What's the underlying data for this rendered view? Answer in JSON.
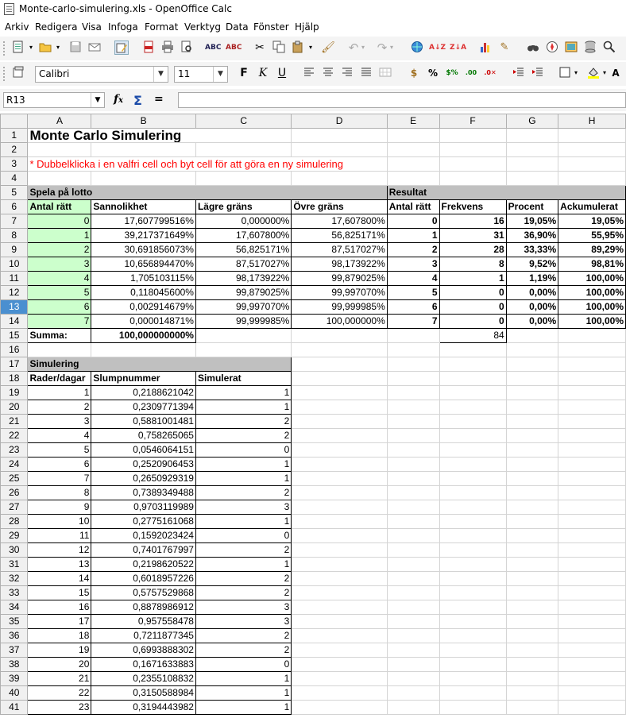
{
  "window": {
    "title": "Monte-carlo-simulering.xls - OpenOffice Calc"
  },
  "menu": [
    "Arkiv",
    "Redigera",
    "Visa",
    "Infoga",
    "Format",
    "Verktyg",
    "Data",
    "Fönster",
    "Hjälp"
  ],
  "format_bar": {
    "font_name": "Calibri",
    "font_size": "11",
    "bold": "F",
    "italic": "K",
    "underline": "U"
  },
  "formula_bar": {
    "cell_ref": "R13",
    "content": ""
  },
  "columns": [
    "A",
    "B",
    "C",
    "D",
    "E",
    "F",
    "G",
    "H"
  ],
  "selected_row": "13",
  "sheet": {
    "title": "Monte Carlo Simulering",
    "note": "* Dubbelklicka i en valfri cell och byt cell för att göra en ny simulering",
    "lotto": {
      "section": "Spela på lotto",
      "headers": [
        "Antal rätt",
        "Sannolikhet",
        "Lägre gräns",
        "Övre gräns"
      ],
      "rows": [
        [
          "0",
          "17,607799516%",
          "0,000000%",
          "17,607800%"
        ],
        [
          "1",
          "39,217371649%",
          "17,607800%",
          "56,825171%"
        ],
        [
          "2",
          "30,691856073%",
          "56,825171%",
          "87,517027%"
        ],
        [
          "3",
          "10,656894470%",
          "87,517027%",
          "98,173922%"
        ],
        [
          "4",
          "1,705103115%",
          "98,173922%",
          "99,879025%"
        ],
        [
          "5",
          "0,118045600%",
          "99,879025%",
          "99,997070%"
        ],
        [
          "6",
          "0,002914679%",
          "99,997070%",
          "99,999985%"
        ],
        [
          "7",
          "0,000014871%",
          "99,999985%",
          "100,000000%"
        ]
      ],
      "sum_label": "Summa:",
      "sum_value": "100,000000000%"
    },
    "result": {
      "section": "Resultat",
      "headers": [
        "Antal rätt",
        "Frekvens",
        "Procent",
        "Ackumulerat"
      ],
      "rows": [
        [
          "0",
          "16",
          "19,05%",
          "19,05%"
        ],
        [
          "1",
          "31",
          "36,90%",
          "55,95%"
        ],
        [
          "2",
          "28",
          "33,33%",
          "89,29%"
        ],
        [
          "3",
          "8",
          "9,52%",
          "98,81%"
        ],
        [
          "4",
          "1",
          "1,19%",
          "100,00%"
        ],
        [
          "5",
          "0",
          "0,00%",
          "100,00%"
        ],
        [
          "6",
          "0",
          "0,00%",
          "100,00%"
        ],
        [
          "7",
          "0",
          "0,00%",
          "100,00%"
        ]
      ],
      "total": "84"
    },
    "simulation": {
      "section": "Simulering",
      "headers": [
        "Rader/dagar",
        "Slumpnummer",
        "Simulerat"
      ],
      "rows": [
        [
          "1",
          "0,2188621042",
          "1"
        ],
        [
          "2",
          "0,2309771394",
          "1"
        ],
        [
          "3",
          "0,5881001481",
          "2"
        ],
        [
          "4",
          "0,758265065",
          "2"
        ],
        [
          "5",
          "0,0546064151",
          "0"
        ],
        [
          "6",
          "0,2520906453",
          "1"
        ],
        [
          "7",
          "0,2650929319",
          "1"
        ],
        [
          "8",
          "0,7389349488",
          "2"
        ],
        [
          "9",
          "0,9703119989",
          "3"
        ],
        [
          "10",
          "0,2775161068",
          "1"
        ],
        [
          "11",
          "0,1592023424",
          "0"
        ],
        [
          "12",
          "0,7401767997",
          "2"
        ],
        [
          "13",
          "0,2198620522",
          "1"
        ],
        [
          "14",
          "0,6018957226",
          "2"
        ],
        [
          "15",
          "0,5757529868",
          "2"
        ],
        [
          "16",
          "0,8878986912",
          "3"
        ],
        [
          "17",
          "0,957558478",
          "3"
        ],
        [
          "18",
          "0,7211877345",
          "2"
        ],
        [
          "19",
          "0,6993888302",
          "2"
        ],
        [
          "20",
          "0,1671633883",
          "0"
        ],
        [
          "21",
          "0,2355108832",
          "1"
        ],
        [
          "22",
          "0,3150588984",
          "1"
        ],
        [
          "23",
          "0,3194443982",
          "1"
        ]
      ]
    }
  }
}
